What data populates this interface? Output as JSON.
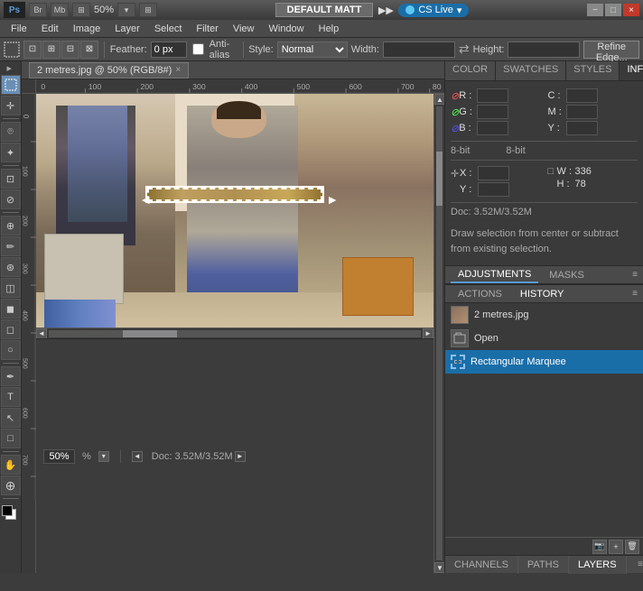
{
  "titlebar": {
    "app_name": "DEFAULT MATT",
    "cs_live_label": "CS Live",
    "zoom_level": "50%",
    "minimize_label": "−",
    "maximize_label": "□",
    "close_label": "×"
  },
  "menubar": {
    "items": [
      "Ps",
      "File",
      "Edit",
      "Image",
      "Layer",
      "Select",
      "Filter",
      "View",
      "Window",
      "Help"
    ]
  },
  "optionsbar": {
    "feather_label": "Feather:",
    "feather_value": "0 px",
    "antialias_label": "Anti-alias",
    "style_label": "Style:",
    "style_value": "Normal",
    "width_label": "Width:",
    "height_label": "Height:",
    "refine_btn_label": "Refine Edge..."
  },
  "canvas": {
    "tab_name": "2 metres.jpg @ 50% (RGB/8#)",
    "ruler_marks": [
      "0",
      "100",
      "200",
      "300",
      "400",
      "500",
      "600",
      "700",
      "80"
    ]
  },
  "tools": [
    {
      "name": "rectangular-marquee-tool",
      "icon": "⬚",
      "active": true
    },
    {
      "name": "move-tool",
      "icon": "✛"
    },
    {
      "name": "lasso-tool",
      "icon": "⌾"
    },
    {
      "name": "magic-wand-tool",
      "icon": "✦"
    },
    {
      "name": "crop-tool",
      "icon": "⊡"
    },
    {
      "name": "eyedropper-tool",
      "icon": "⊘"
    },
    {
      "name": "healing-brush-tool",
      "icon": "⊕"
    },
    {
      "name": "brush-tool",
      "icon": "✏"
    },
    {
      "name": "clone-stamp-tool",
      "icon": "⊛"
    },
    {
      "name": "eraser-tool",
      "icon": "◫"
    },
    {
      "name": "gradient-tool",
      "icon": "◫"
    },
    {
      "name": "blur-tool",
      "icon": "◻"
    },
    {
      "name": "dodge-tool",
      "icon": "○"
    },
    {
      "name": "pen-tool",
      "icon": "✒"
    },
    {
      "name": "type-tool",
      "icon": "T"
    },
    {
      "name": "path-selection-tool",
      "icon": "↖"
    },
    {
      "name": "rectangle-shape-tool",
      "icon": "□"
    },
    {
      "name": "hand-tool",
      "icon": "✋"
    },
    {
      "name": "zoom-tool",
      "icon": "⊕"
    }
  ],
  "info_panel": {
    "tabs": [
      "COLOR",
      "SWATCHES",
      "STYLES",
      "INFO"
    ],
    "active_tab": "INFO",
    "r_label": "R :",
    "g_label": "G :",
    "b_label": "B :",
    "c_label": "C :",
    "m_label": "M :",
    "y_label": "Y :",
    "bit_label_left": "8-bit",
    "bit_label_right": "8-bit",
    "x_label": "X :",
    "y_coord_label": "Y :",
    "w_label": "W :",
    "h_label": "H :",
    "w_value": "336",
    "h_value": "78",
    "doc_info": "Doc: 3.52M/3.52M",
    "hint": "Draw selection from center or subtract from existing selection."
  },
  "adjustments_panel": {
    "tabs": [
      "ADJUSTMENTS",
      "MASKS"
    ],
    "active_tab": "ADJUSTMENTS"
  },
  "history_panel": {
    "tabs": [
      "ACTIONS",
      "HISTORY"
    ],
    "active_tab": "HISTORY",
    "items": [
      {
        "name": "2 metres.jpg",
        "type": "image",
        "active": false
      },
      {
        "name": "Open",
        "type": "action",
        "active": false
      },
      {
        "name": "Rectangular Marquee",
        "type": "marquee",
        "active": true
      }
    ]
  },
  "bottom_panels": {
    "tabs": [
      "CHANNELS",
      "PATHS",
      "LAYERS"
    ]
  },
  "statusbar": {
    "zoom_value": "50%",
    "doc_info": "Doc: 3.52M/3.52M"
  }
}
